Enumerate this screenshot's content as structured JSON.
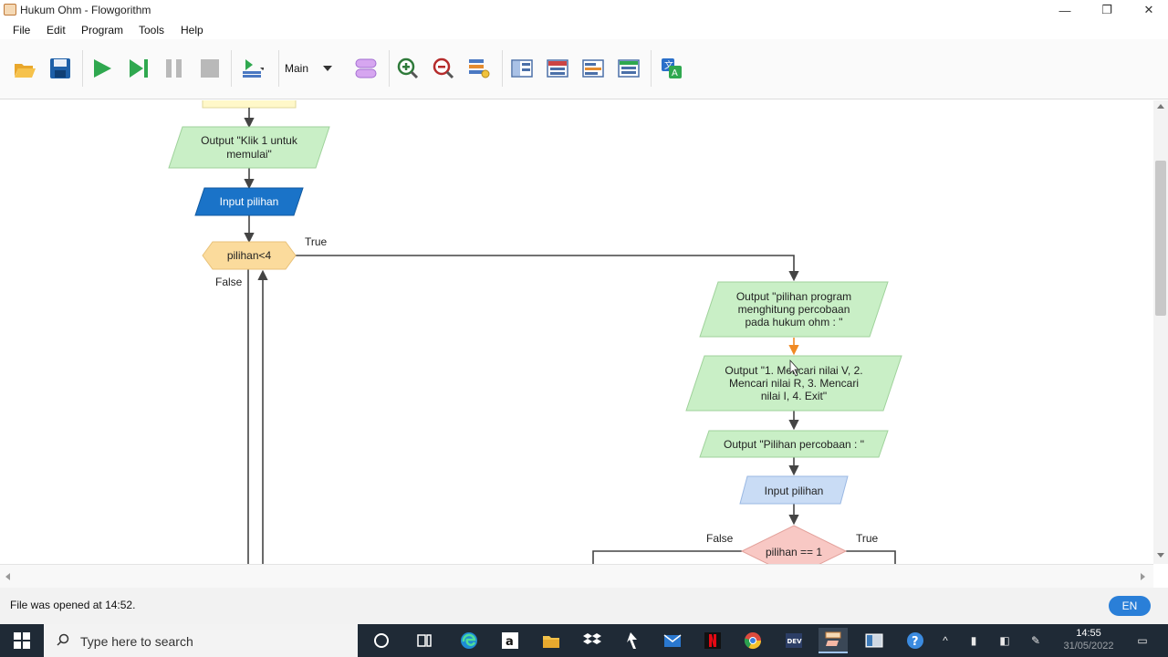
{
  "window": {
    "title": "Hukum Ohm - Flowgorithm",
    "minimize_glyph": "—",
    "restore_glyph": "❐",
    "close_glyph": "✕"
  },
  "menu": [
    "File",
    "Edit",
    "Program",
    "Tools",
    "Help"
  ],
  "toolbar": {
    "function_select": "Main",
    "icons": [
      "open-folder-icon",
      "save-icon",
      "run-icon",
      "step-icon",
      "pause-icon",
      "stop-icon",
      "run-speed-icon",
      "function-list-icon",
      "zoom-in-icon",
      "zoom-out-icon",
      "variable-watch-icon",
      "layout-1-icon",
      "layout-2-icon",
      "layout-3-icon",
      "layout-4-icon",
      "translate-icon"
    ]
  },
  "flowchart": {
    "nodes": {
      "output_klik": [
        "Output \"Klik 1 untuk",
        "memulai\""
      ],
      "input_pilihan_top": "Input pilihan",
      "loop_condition": "pilihan<4",
      "output_program": [
        "Output \"pilihan program",
        "menghitung percobaan",
        "pada hukum ohm : \""
      ],
      "output_menu": [
        "Output \"1. Mencari nilai V, 2.",
        "Mencari nilai R, 3. Mencari",
        "nilai I, 4. Exit\""
      ],
      "output_percobaan": "Output \"Pilihan percobaan : \"",
      "input_pilihan_right": "Input pilihan",
      "if_condition": "pilihan == 1"
    },
    "labels": {
      "loop_true": "True",
      "loop_false": "False",
      "if_false": "False",
      "if_true": "True"
    },
    "colors": {
      "output_fill": "#c9efc6",
      "input_fill_active": "#1a73c8",
      "input_fill": "#c9dcf5",
      "loop_fill": "#fbdb9c",
      "if_fill": "#f8c8c4",
      "connector": "#444444",
      "connector_highlight": "#f08a24"
    }
  },
  "status": {
    "message": "File was opened at 14:52.",
    "language": "EN"
  },
  "taskbar": {
    "search_placeholder": "Type here to search",
    "time": "14:55",
    "date": "31/05/2022",
    "apps": [
      "cortana-icon",
      "task-view-icon",
      "edge-icon",
      "amazon-icon",
      "file-explorer-icon",
      "dropbox-icon",
      "cursor-app-icon",
      "mail-icon",
      "netflix-icon",
      "chrome-icon",
      "dev-icon",
      "flowgorithm-icon",
      "window-app-icon",
      "help-icon"
    ]
  }
}
